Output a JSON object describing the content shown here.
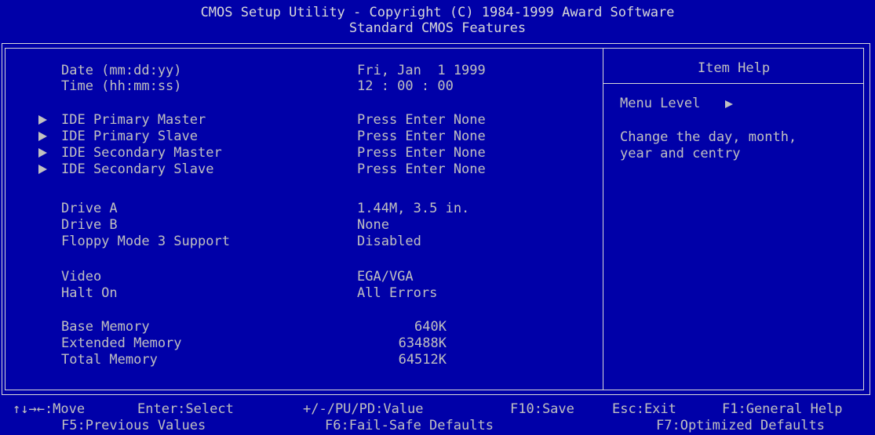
{
  "header": {
    "line1": "CMOS Setup Utility - Copyright (C) 1984-1999 Award Software",
    "line2": "Standard CMOS Features"
  },
  "settings": {
    "date_label": "Date (mm:dd:yy)",
    "date_value": "Fri, Jan  1 1999",
    "time_label": "Time (hh:mm:ss)",
    "time_value": "12 : 00 : 00",
    "ide": [
      {
        "label": "IDE Primary Master",
        "value": "Press Enter None"
      },
      {
        "label": "IDE Primary Slave",
        "value": "Press Enter None"
      },
      {
        "label": "IDE Secondary Master",
        "value": "Press Enter None"
      },
      {
        "label": "IDE Secondary Slave",
        "value": "Press Enter None"
      }
    ],
    "drive_a_label": "Drive A",
    "drive_a_value": "1.44M, 3.5 in.",
    "drive_b_label": "Drive B",
    "drive_b_value": "None",
    "floppy_label": "Floppy Mode 3 Support",
    "floppy_value": "Disabled",
    "video_label": "Video",
    "video_value": "EGA/VGA",
    "halt_label": "Halt On",
    "halt_value": "All Errors",
    "base_mem_label": "Base Memory",
    "base_mem_value": "640K",
    "ext_mem_label": "Extended Memory",
    "ext_mem_value": "63488K",
    "total_mem_label": "Total Memory",
    "total_mem_value": "64512K"
  },
  "help": {
    "title": "Item Help",
    "menu_level": "Menu Level",
    "text_line1": "Change the day, month,",
    "text_line2": "year and centry"
  },
  "footer": {
    "move": "↑↓→←:Move",
    "enter": "Enter:Select",
    "value": "+/-/PU/PD:Value",
    "f10": "F10:Save",
    "esc": "Esc:Exit",
    "f1": "F1:General Help",
    "f5": "F5:Previous Values",
    "f6": "F6:Fail-Safe Defaults",
    "f7": "F7:Optimized Defaults"
  },
  "colors": {
    "background": "#0000a8",
    "text": "#c0c0c0"
  }
}
